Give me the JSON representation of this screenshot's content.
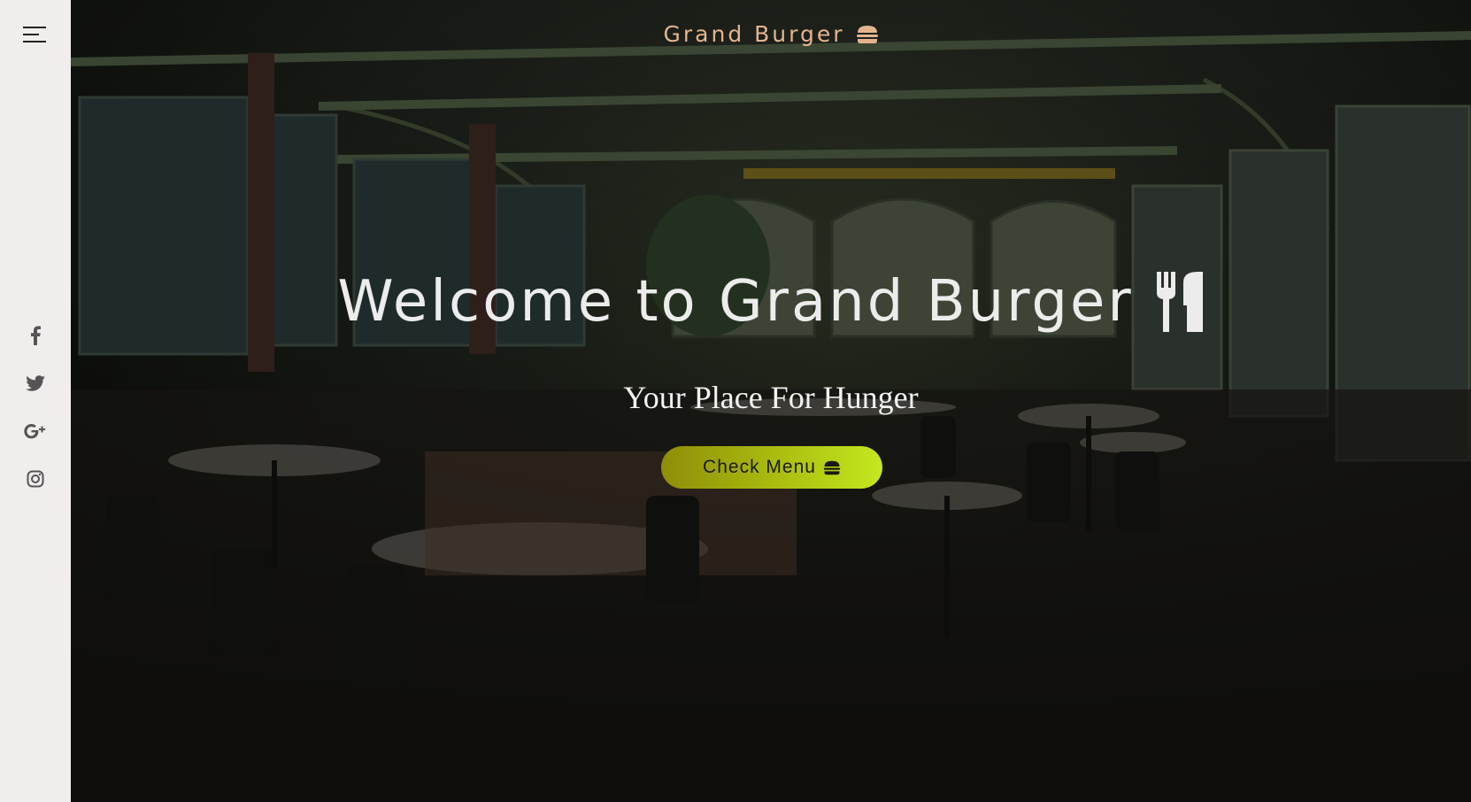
{
  "brand": {
    "name": "Grand Burger",
    "icon": "burger-icon",
    "color": "#e4b48f"
  },
  "sidebar": {
    "menu_icon": "hamburger-menu-icon",
    "social": [
      {
        "name": "facebook",
        "icon": "facebook-icon"
      },
      {
        "name": "twitter",
        "icon": "twitter-icon"
      },
      {
        "name": "google-plus",
        "icon": "google-plus-icon"
      },
      {
        "name": "instagram",
        "icon": "instagram-icon"
      }
    ],
    "background": "#f2eded"
  },
  "hero": {
    "title": "Welcome to Grand Burger",
    "title_icon": "cutlery-icon",
    "subtitle": "Your Place For Hunger",
    "cta_label": "Check Menu",
    "cta_icon": "burger-icon",
    "cta_gradient": [
      "#8f8d0a",
      "#c4e81f"
    ]
  }
}
